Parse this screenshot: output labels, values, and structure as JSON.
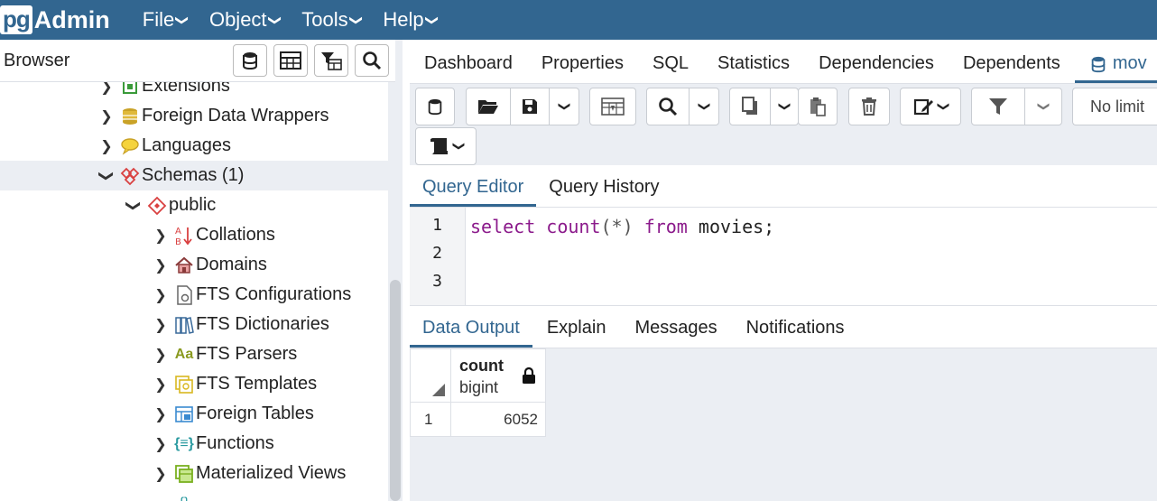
{
  "navbar": {
    "logo_pg": "pg",
    "logo_admin": "Admin",
    "menus": [
      "File",
      "Object",
      "Tools",
      "Help"
    ]
  },
  "browser": {
    "title": "Browser",
    "tree": [
      {
        "label": "Extensions",
        "icon": "extensions-icon",
        "level": 1,
        "expanded": false
      },
      {
        "label": "Foreign Data Wrappers",
        "icon": "foreign-data-wrappers-icon",
        "level": 1,
        "expanded": false
      },
      {
        "label": "Languages",
        "icon": "languages-icon",
        "level": 1,
        "expanded": false
      },
      {
        "label": "Schemas (1)",
        "icon": "schemas-icon",
        "level": 1,
        "expanded": true,
        "selected": true
      },
      {
        "label": "public",
        "icon": "schema-icon",
        "level": 2,
        "expanded": true
      },
      {
        "label": "Collations",
        "icon": "collations-icon",
        "level": 3,
        "expanded": false
      },
      {
        "label": "Domains",
        "icon": "domains-icon",
        "level": 3,
        "expanded": false
      },
      {
        "label": "FTS Configurations",
        "icon": "fts-configurations-icon",
        "level": 3,
        "expanded": false
      },
      {
        "label": "FTS Dictionaries",
        "icon": "fts-dictionaries-icon",
        "level": 3,
        "expanded": false
      },
      {
        "label": "FTS Parsers",
        "icon": "fts-parsers-icon",
        "level": 3,
        "expanded": false
      },
      {
        "label": "FTS Templates",
        "icon": "fts-templates-icon",
        "level": 3,
        "expanded": false
      },
      {
        "label": "Foreign Tables",
        "icon": "foreign-tables-icon",
        "level": 3,
        "expanded": false
      },
      {
        "label": "Functions",
        "icon": "functions-icon",
        "level": 3,
        "expanded": false
      },
      {
        "label": "Materialized Views",
        "icon": "materialized-views-icon",
        "level": 3,
        "expanded": false
      }
    ]
  },
  "main_tabs": [
    "Dashboard",
    "Properties",
    "SQL",
    "Statistics",
    "Dependencies",
    "Dependents",
    "mov"
  ],
  "toolbar": {
    "limit_label": "No limit"
  },
  "editor_tabs": [
    "Query Editor",
    "Query History"
  ],
  "editor": {
    "line_numbers": [
      "1",
      "2",
      "3"
    ],
    "kw_select": "select",
    "fn_count": "count",
    "args": "(*)",
    "kw_from": "from",
    "table": "movies;"
  },
  "result_tabs": [
    "Data Output",
    "Explain",
    "Messages",
    "Notifications"
  ],
  "result": {
    "column_name": "count",
    "column_type": "bigint",
    "rows": [
      {
        "row_num": "1",
        "value": "6052"
      }
    ]
  },
  "colors": {
    "brand": "#326690",
    "keyword": "#8b1a8b"
  }
}
